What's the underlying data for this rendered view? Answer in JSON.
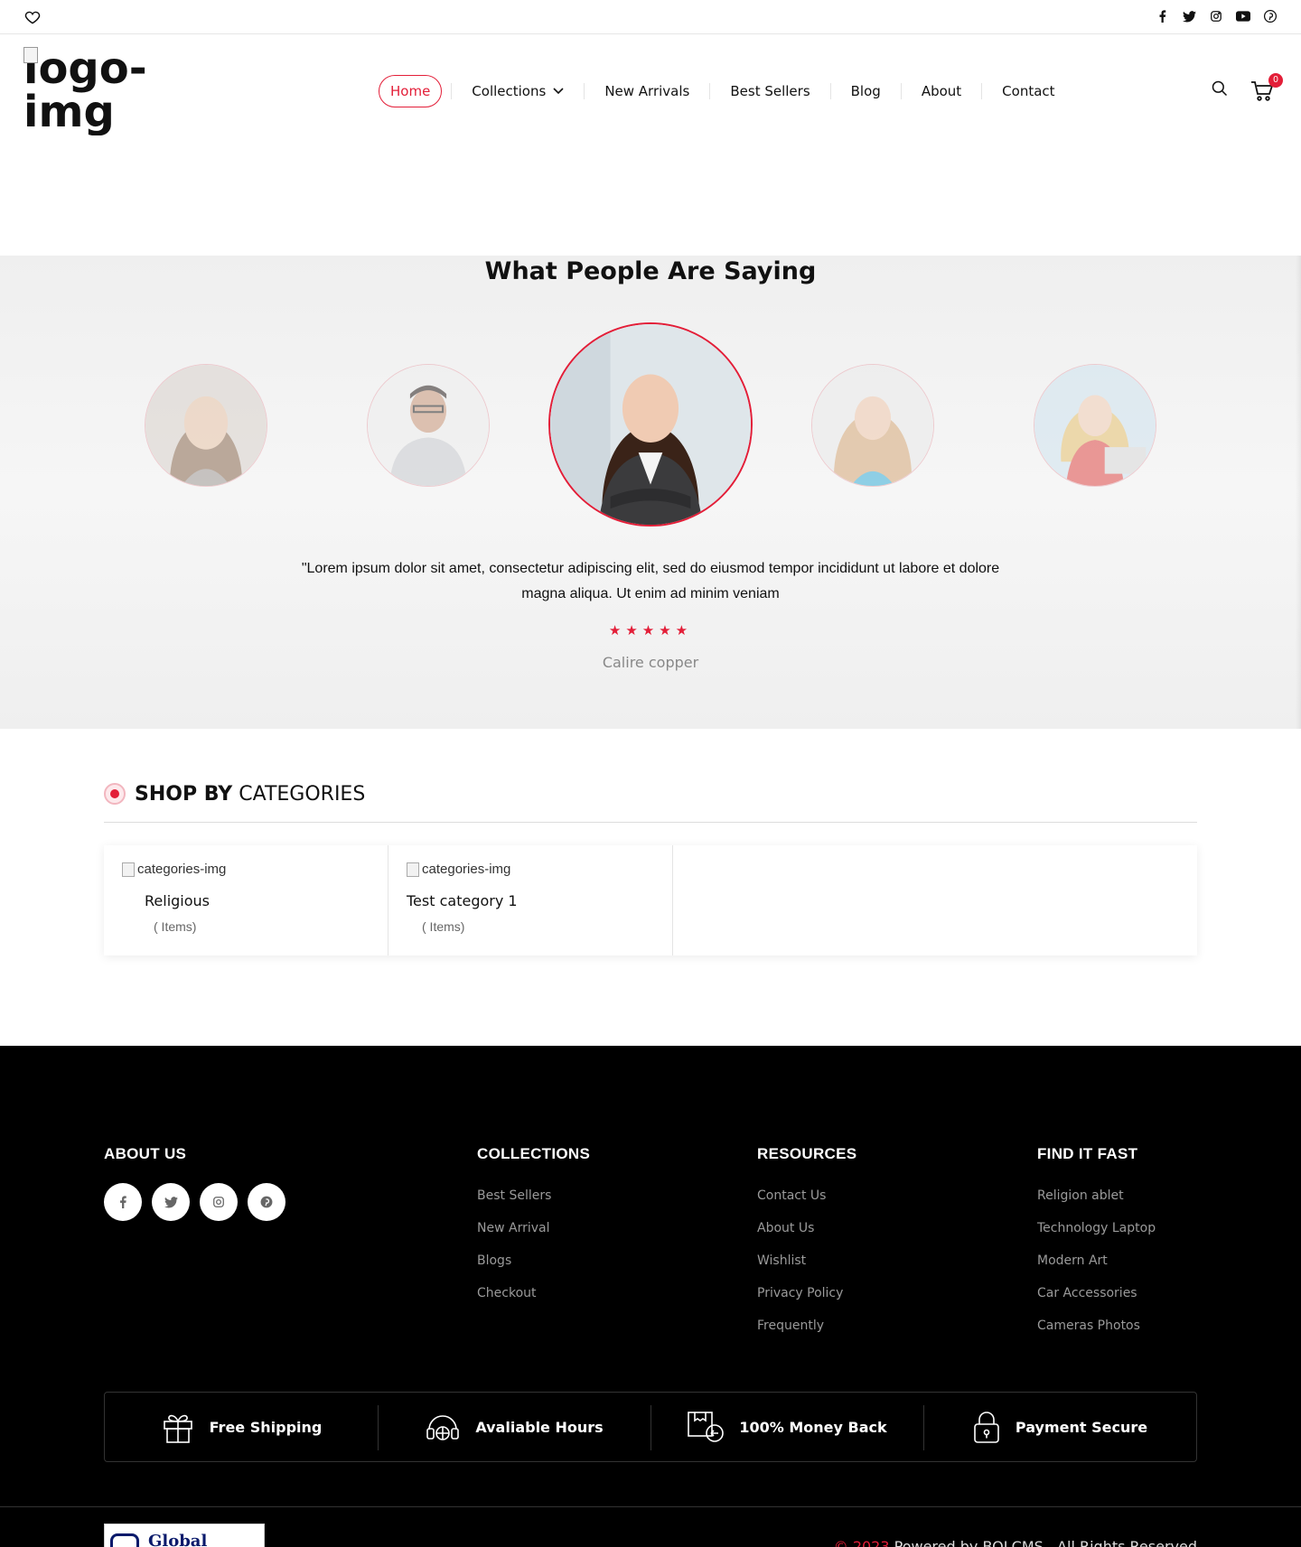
{
  "nav": {
    "items": [
      "Home",
      "Collections",
      "New Arrivals",
      "Best Sellers",
      "Blog",
      "About",
      "Contact"
    ],
    "active": "Home"
  },
  "header": {
    "logo_alt": "logo-img",
    "cart_count": "0"
  },
  "testimonials": {
    "title": "What People Are Saying",
    "quote": "\"Lorem ipsum dolor sit amet, consectetur adipiscing elit, sed do eiusmod tempor incididunt ut labore et dolore magna aliqua. Ut enim ad minim veniam",
    "rating": 5,
    "stars": "★★★★★",
    "author": "Calire copper"
  },
  "categories": {
    "title_bold": "SHOP BY",
    "title_light": "CATEGORIES",
    "items": [
      {
        "img_alt": "categories-img",
        "name": "Religious",
        "count": "( Items)"
      },
      {
        "img_alt": "categories-img",
        "name": "Test category 1",
        "count": "( Items)"
      }
    ]
  },
  "footer": {
    "about": {
      "title": "ABOUT US"
    },
    "collections": {
      "title": "COLLECTIONS",
      "links": [
        "Best Sellers",
        "New Arrival",
        "Blogs",
        "Checkout"
      ]
    },
    "resources": {
      "title": "RESOURCES",
      "links": [
        "Contact Us",
        "About Us",
        "Wishlist",
        "Privacy Policy",
        "Frequently"
      ]
    },
    "find": {
      "title": "FIND IT FAST",
      "links": [
        "Religion ablet",
        "Technology Laptop",
        "Modern Art",
        "Car Accessories",
        "Cameras Photos"
      ]
    },
    "features": [
      "Free Shipping",
      "Avaliable Hours",
      "100% Money Back",
      "Payment Secure"
    ],
    "logo_text": "Global Studio",
    "copyright_year": "© 2023",
    "copyright_text": " Powered by BOLCMS . All Rights Reserved"
  },
  "colors": {
    "accent": "#e31e38",
    "footer_bg": "#000000",
    "section_bg": "#f2f2f2"
  }
}
